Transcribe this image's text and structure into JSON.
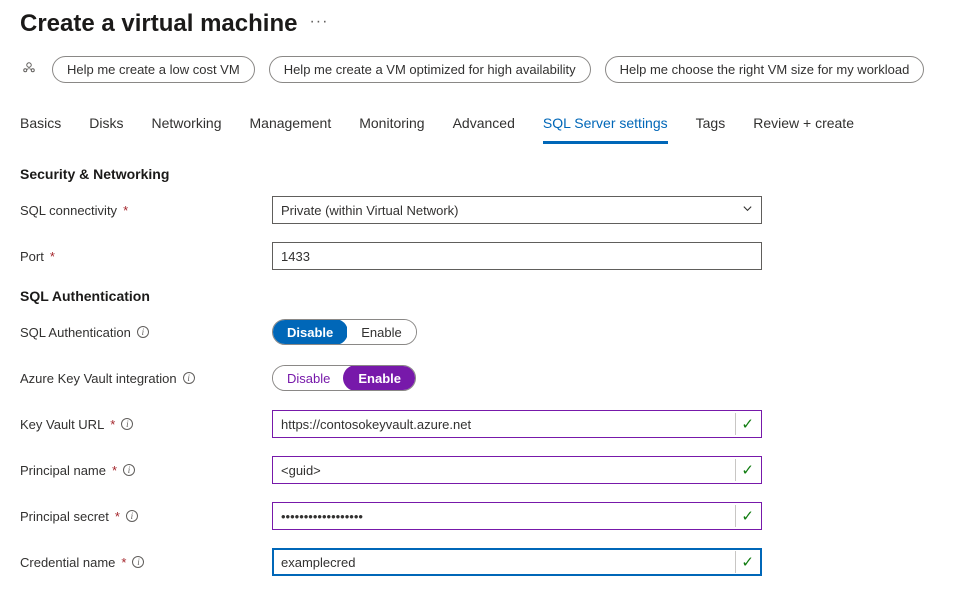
{
  "title": "Create a virtual machine",
  "suggestions": {
    "s1": "Help me create a low cost VM",
    "s2": "Help me create a VM optimized for high availability",
    "s3": "Help me choose the right VM size for my workload"
  },
  "tabs": {
    "basics": "Basics",
    "disks": "Disks",
    "networking": "Networking",
    "management": "Management",
    "monitoring": "Monitoring",
    "advanced": "Advanced",
    "sql": "SQL Server settings",
    "tags": "Tags",
    "review": "Review + create"
  },
  "sections": {
    "secnet": "Security & Networking",
    "sqlauth": "SQL Authentication"
  },
  "labels": {
    "sql_connectivity": "SQL connectivity",
    "port": "Port",
    "sql_auth": "SQL Authentication",
    "akv": "Azure Key Vault integration",
    "kv_url": "Key Vault URL",
    "principal_name": "Principal name",
    "principal_secret": "Principal secret",
    "credential_name": "Credential name"
  },
  "values": {
    "sql_connectivity": "Private (within Virtual Network)",
    "port": "1433",
    "kv_url": "https://contosokeyvault.azure.net",
    "principal_name": "<guid>",
    "principal_secret": "••••••••••••••••••",
    "credential_name": "examplecred"
  },
  "toggle": {
    "disable": "Disable",
    "enable": "Enable"
  }
}
